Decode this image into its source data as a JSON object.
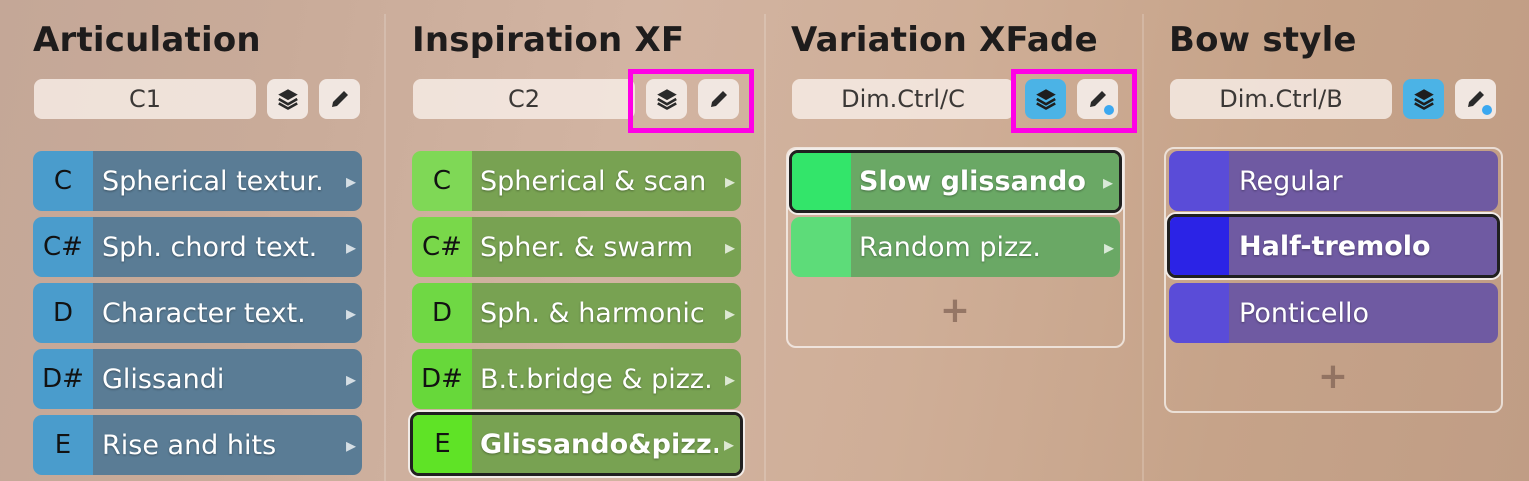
{
  "columns": [
    {
      "title": "Articulation",
      "selector": "C1",
      "items": [
        {
          "key": "C",
          "label": "Spherical textur."
        },
        {
          "key": "C#",
          "label": "Sph. chord text."
        },
        {
          "key": "D",
          "label": "Character text."
        },
        {
          "key": "D#",
          "label": "Glissandi"
        },
        {
          "key": "E",
          "label": "Rise and hits"
        }
      ]
    },
    {
      "title": "Inspiration XF",
      "selector": "C2",
      "items": [
        {
          "key": "C",
          "label": "Spherical & scan"
        },
        {
          "key": "C#",
          "label": "Spher. & swarm"
        },
        {
          "key": "D",
          "label": "Sph. & harmonic"
        },
        {
          "key": "D#",
          "label": "B.t.bridge & pizz."
        },
        {
          "key": "E",
          "label": "Glissando&pizz."
        }
      ]
    },
    {
      "title": "Variation XFade",
      "selector": "Dim.Ctrl/C",
      "items": [
        {
          "key": "",
          "label": "Slow glissando"
        },
        {
          "key": "",
          "label": "Random pizz."
        }
      ],
      "add_label": "+"
    },
    {
      "title": "Bow style",
      "selector": "Dim.Ctrl/B",
      "items": [
        {
          "key": "",
          "label": "Regular"
        },
        {
          "key": "",
          "label": "Half-tremolo"
        },
        {
          "key": "",
          "label": "Ponticello"
        }
      ],
      "add_label": "+"
    }
  ],
  "icons": {
    "layers": "layers-icon",
    "edit": "pencil-icon",
    "chevron": "chevron-right-icon",
    "add": "plus-icon"
  },
  "colors": {
    "articulation_key": "#4a9ccc",
    "articulation_label": "#5a7c95",
    "inspiration_key": "#79d84a",
    "inspiration_label": "#78a252",
    "variation_key": "#33e56a",
    "variation_label": "#6aa865",
    "bow_key": "#5a4cd8",
    "bow_label": "#6f5aa2",
    "active_button": "#4bb3e6",
    "highlight": "#ff00e6"
  }
}
